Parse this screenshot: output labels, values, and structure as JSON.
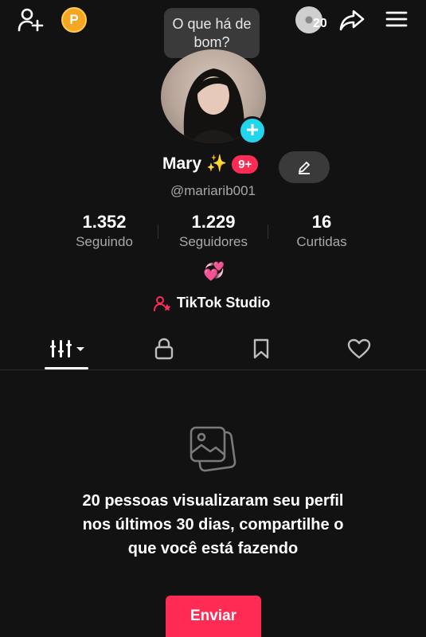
{
  "header": {
    "add_friend_icon": "person-plus-icon",
    "coin_label": "P",
    "tooltip": "O que há de bom?",
    "views_count": "20",
    "share_icon": "share-arrow-icon",
    "menu_icon": "hamburger-menu-icon"
  },
  "profile": {
    "name": "Mary",
    "sparkle": "✨",
    "badge": "9+",
    "handle": "@mariarib001",
    "bio_emoji": "💞"
  },
  "stats": [
    {
      "value": "1.352",
      "label": "Seguindo"
    },
    {
      "value": "1.229",
      "label": "Seguidores"
    },
    {
      "value": "16",
      "label": "Curtidas"
    }
  ],
  "studio": {
    "label": "TikTok Studio"
  },
  "tabs": [
    "videos-grid-icon",
    "lock-icon",
    "bookmark-icon",
    "heart-icon"
  ],
  "empty_state": {
    "message": "20 pessoas visualizaram seu perfil nos últimos 30 dias, compartilhe o que você está fazendo",
    "button": "Enviar"
  },
  "colors": {
    "accent": "#fe2c55",
    "avatar_add": "#20d5ec",
    "coin": "#f5a623",
    "background": "#121212"
  }
}
